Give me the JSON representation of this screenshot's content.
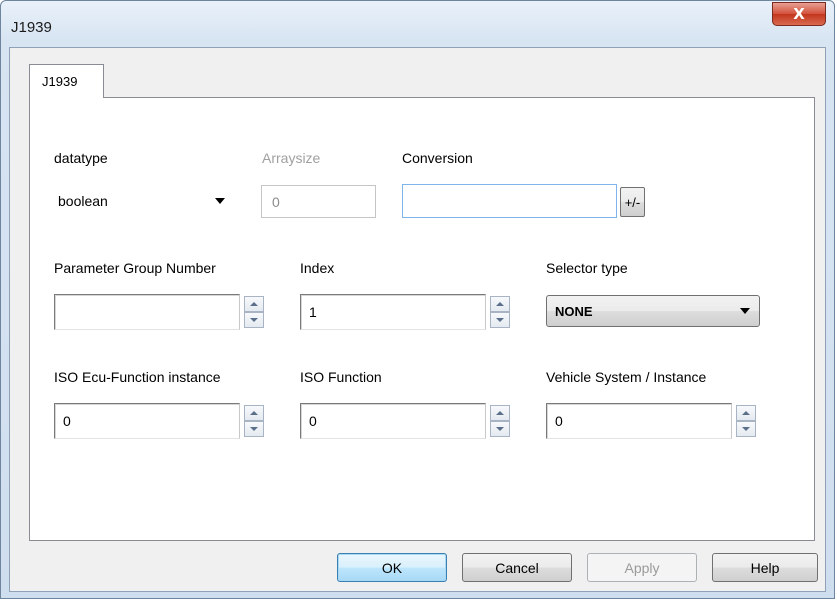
{
  "window": {
    "title": "J1939",
    "close_glyph": "X"
  },
  "tabs": [
    {
      "label": "J1939"
    }
  ],
  "fields": {
    "datatype": {
      "label": "datatype",
      "value": "boolean"
    },
    "arraysize": {
      "label": "Arraysize",
      "value": "0"
    },
    "conversion": {
      "label": "Conversion",
      "value": "",
      "button_label": "+/-"
    },
    "pgn": {
      "label": "Parameter Group Number",
      "value": ""
    },
    "index": {
      "label": "Index",
      "value": "1"
    },
    "selector_type": {
      "label": "Selector type",
      "value": "NONE"
    },
    "iso_ecu_function_instance": {
      "label": "ISO Ecu-Function instance",
      "value": "0"
    },
    "iso_function": {
      "label": "ISO Function",
      "value": "0"
    },
    "vehicle_system_instance": {
      "label": "Vehicle System / Instance",
      "value": "0"
    }
  },
  "buttons": {
    "ok": "OK",
    "cancel": "Cancel",
    "apply": "Apply",
    "help": "Help"
  },
  "colors": {
    "close_button": "#c9412a",
    "default_button_border": "#3c7fb1",
    "disabled_text": "#a0a0a0"
  }
}
